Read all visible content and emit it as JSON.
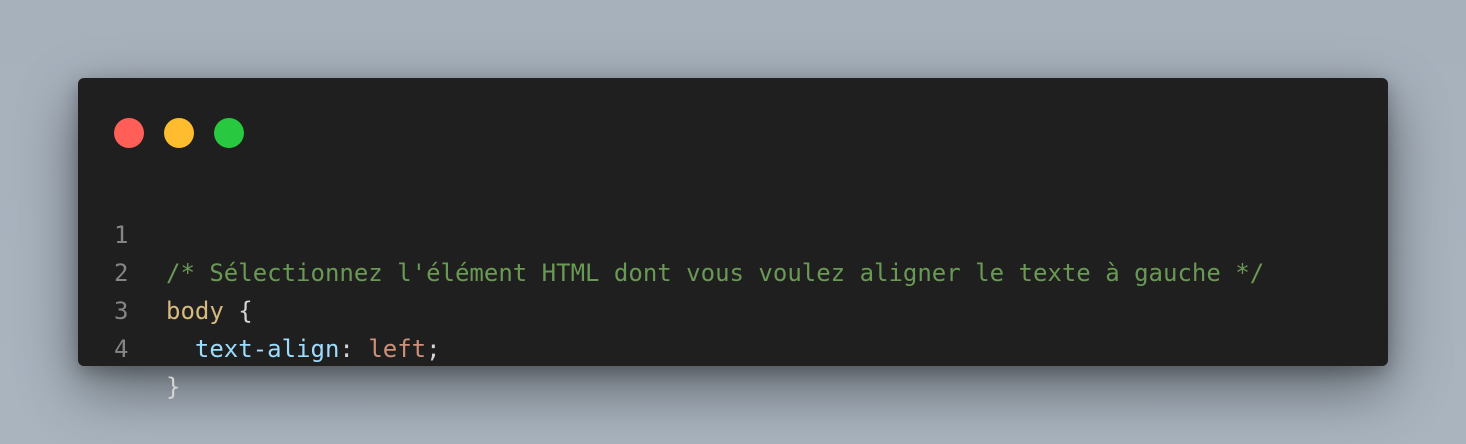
{
  "colors": {
    "background": "#a8b3be",
    "window": "#1f1f1f",
    "dot_close": "#ff5f57",
    "dot_minimize": "#febc2e",
    "dot_maximize": "#28c840",
    "comment": "#6a9955",
    "selector": "#d7ba7d",
    "property": "#9cdcfe",
    "value": "#ce9178",
    "punctuation": "#d4d4d4",
    "line_number": "#858585"
  },
  "window_controls": [
    {
      "name": "close",
      "icon": "red-dot-icon"
    },
    {
      "name": "minimize",
      "icon": "yellow-dot-icon"
    },
    {
      "name": "maximize",
      "icon": "green-dot-icon"
    }
  ],
  "code": {
    "language": "css",
    "lines": [
      {
        "number": "1",
        "comment": "/* Sélectionnez l'élément HTML dont vous voulez aligner le texte à gauche */"
      },
      {
        "number": "2",
        "selector": "body",
        "space": " ",
        "brace_open": "{"
      },
      {
        "number": "3",
        "indent": "  ",
        "property": "text-align",
        "colon": ": ",
        "value": "left",
        "semicolon": ";"
      },
      {
        "number": "4",
        "brace_close": "}"
      }
    ]
  }
}
